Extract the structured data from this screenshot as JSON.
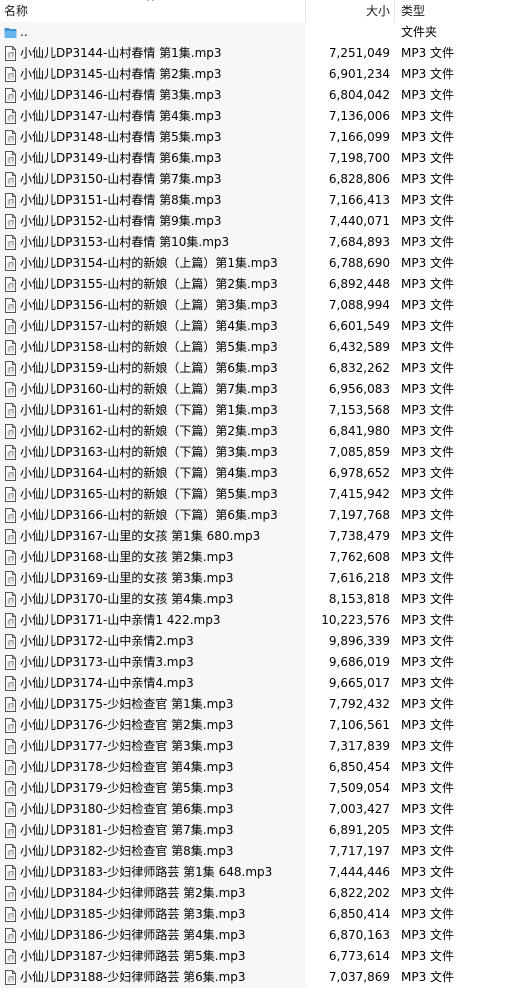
{
  "columns": {
    "name": "名称",
    "size": "大小",
    "type": "类型",
    "sort_arrow": "^"
  },
  "parent_row": {
    "name": "..",
    "size": "",
    "type": "文件夹",
    "icon": "folder-up-icon"
  },
  "files": [
    {
      "name": "小仙儿DP3144-山村春情 第1集.mp3",
      "size": "7,251,049",
      "type": "MP3 文件"
    },
    {
      "name": "小仙儿DP3145-山村春情 第2集.mp3",
      "size": "6,901,234",
      "type": "MP3 文件"
    },
    {
      "name": "小仙儿DP3146-山村春情 第3集.mp3",
      "size": "6,804,042",
      "type": "MP3 文件"
    },
    {
      "name": "小仙儿DP3147-山村春情 第4集.mp3",
      "size": "7,136,006",
      "type": "MP3 文件"
    },
    {
      "name": "小仙儿DP3148-山村春情 第5集.mp3",
      "size": "7,166,099",
      "type": "MP3 文件"
    },
    {
      "name": "小仙儿DP3149-山村春情 第6集.mp3",
      "size": "7,198,700",
      "type": "MP3 文件"
    },
    {
      "name": "小仙儿DP3150-山村春情 第7集.mp3",
      "size": "6,828,806",
      "type": "MP3 文件"
    },
    {
      "name": "小仙儿DP3151-山村春情 第8集.mp3",
      "size": "7,166,413",
      "type": "MP3 文件"
    },
    {
      "name": "小仙儿DP3152-山村春情 第9集.mp3",
      "size": "7,440,071",
      "type": "MP3 文件"
    },
    {
      "name": "小仙儿DP3153-山村春情 第10集.mp3",
      "size": "7,684,893",
      "type": "MP3 文件"
    },
    {
      "name": "小仙儿DP3154-山村的新娘（上篇）第1集.mp3",
      "size": "6,788,690",
      "type": "MP3 文件"
    },
    {
      "name": "小仙儿DP3155-山村的新娘（上篇）第2集.mp3",
      "size": "6,892,448",
      "type": "MP3 文件"
    },
    {
      "name": "小仙儿DP3156-山村的新娘（上篇）第3集.mp3",
      "size": "7,088,994",
      "type": "MP3 文件"
    },
    {
      "name": "小仙儿DP3157-山村的新娘（上篇）第4集.mp3",
      "size": "6,601,549",
      "type": "MP3 文件"
    },
    {
      "name": "小仙儿DP3158-山村的新娘（上篇）第5集.mp3",
      "size": "6,432,589",
      "type": "MP3 文件"
    },
    {
      "name": "小仙儿DP3159-山村的新娘（上篇）第6集.mp3",
      "size": "6,832,262",
      "type": "MP3 文件"
    },
    {
      "name": "小仙儿DP3160-山村的新娘（上篇）第7集.mp3",
      "size": "6,956,083",
      "type": "MP3 文件"
    },
    {
      "name": "小仙儿DP3161-山村的新娘（下篇）第1集.mp3",
      "size": "7,153,568",
      "type": "MP3 文件"
    },
    {
      "name": "小仙儿DP3162-山村的新娘（下篇）第2集.mp3",
      "size": "6,841,980",
      "type": "MP3 文件"
    },
    {
      "name": "小仙儿DP3163-山村的新娘（下篇）第3集.mp3",
      "size": "7,085,859",
      "type": "MP3 文件"
    },
    {
      "name": "小仙儿DP3164-山村的新娘（下篇）第4集.mp3",
      "size": "6,978,652",
      "type": "MP3 文件"
    },
    {
      "name": "小仙儿DP3165-山村的新娘（下篇）第5集.mp3",
      "size": "7,415,942",
      "type": "MP3 文件"
    },
    {
      "name": "小仙儿DP3166-山村的新娘（下篇）第6集.mp3",
      "size": "7,197,768",
      "type": "MP3 文件"
    },
    {
      "name": "小仙儿DP3167-山里的女孩 第1集 680.mp3",
      "size": "7,738,479",
      "type": "MP3 文件"
    },
    {
      "name": "小仙儿DP3168-山里的女孩 第2集.mp3",
      "size": "7,762,608",
      "type": "MP3 文件"
    },
    {
      "name": "小仙儿DP3169-山里的女孩 第3集.mp3",
      "size": "7,616,218",
      "type": "MP3 文件"
    },
    {
      "name": "小仙儿DP3170-山里的女孩 第4集.mp3",
      "size": "8,153,818",
      "type": "MP3 文件"
    },
    {
      "name": "小仙儿DP3171-山中亲情1 422.mp3",
      "size": "10,223,576",
      "type": "MP3 文件"
    },
    {
      "name": "小仙儿DP3172-山中亲情2.mp3",
      "size": "9,896,339",
      "type": "MP3 文件"
    },
    {
      "name": "小仙儿DP3173-山中亲情3.mp3",
      "size": "9,686,019",
      "type": "MP3 文件"
    },
    {
      "name": "小仙儿DP3174-山中亲情4.mp3",
      "size": "9,665,017",
      "type": "MP3 文件"
    },
    {
      "name": "小仙儿DP3175-少妇检查官 第1集.mp3",
      "size": "7,792,432",
      "type": "MP3 文件"
    },
    {
      "name": "小仙儿DP3176-少妇检查官 第2集.mp3",
      "size": "7,106,561",
      "type": "MP3 文件"
    },
    {
      "name": "小仙儿DP3177-少妇检查官 第3集.mp3",
      "size": "7,317,839",
      "type": "MP3 文件"
    },
    {
      "name": "小仙儿DP3178-少妇检查官 第4集.mp3",
      "size": "6,850,454",
      "type": "MP3 文件"
    },
    {
      "name": "小仙儿DP3179-少妇检查官 第5集.mp3",
      "size": "7,509,054",
      "type": "MP3 文件"
    },
    {
      "name": "小仙儿DP3180-少妇检查官 第6集.mp3",
      "size": "7,003,427",
      "type": "MP3 文件"
    },
    {
      "name": "小仙儿DP3181-少妇检查官 第7集.mp3",
      "size": "6,891,205",
      "type": "MP3 文件"
    },
    {
      "name": "小仙儿DP3182-少妇检查官 第8集.mp3",
      "size": "7,717,197",
      "type": "MP3 文件"
    },
    {
      "name": "小仙儿DP3183-少妇律师路芸 第1集 648.mp3",
      "size": "7,444,446",
      "type": "MP3 文件"
    },
    {
      "name": "小仙儿DP3184-少妇律师路芸 第2集.mp3",
      "size": "6,822,202",
      "type": "MP3 文件"
    },
    {
      "name": "小仙儿DP3185-少妇律师路芸 第3集.mp3",
      "size": "6,850,414",
      "type": "MP3 文件"
    },
    {
      "name": "小仙儿DP3186-少妇律师路芸 第4集.mp3",
      "size": "6,870,163",
      "type": "MP3 文件"
    },
    {
      "name": "小仙儿DP3187-少妇律师路芸 第5集.mp3",
      "size": "6,773,614",
      "type": "MP3 文件"
    },
    {
      "name": "小仙儿DP3188-少妇律师路芸 第6集.mp3",
      "size": "7,037,869",
      "type": "MP3 文件"
    }
  ],
  "file_icon": "mp3-file-icon",
  "colors": {
    "name_column_bg": "#f7f7f7",
    "folder_blue": "#3f8fd2",
    "folder_blue_light": "#67b4ef",
    "separator": "#e5e5e5"
  }
}
